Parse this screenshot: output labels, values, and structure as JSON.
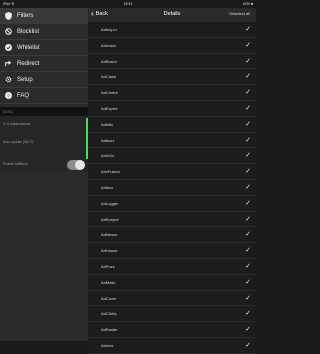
{
  "status_bar": {
    "left": "iPad 令",
    "time": "18:41",
    "battery": "60% ■"
  },
  "sidebar": {
    "items": [
      {
        "label": "Filters",
        "icon": "shield-icon",
        "active": true
      },
      {
        "label": "Blocklist",
        "icon": "block-icon",
        "active": false
      },
      {
        "label": "Whitelist",
        "icon": "check-circle-icon",
        "active": false
      },
      {
        "label": "Redirect",
        "icon": "redirect-icon",
        "active": false
      },
      {
        "label": "Setup",
        "icon": "gear-icon",
        "active": false
      },
      {
        "label": "FAQ",
        "icon": "question-icon",
        "active": false
      }
    ],
    "section_header": "BASIC",
    "settings": [
      "3 rd subscriptions",
      "Auto-update (Wi-Fi)",
      "Enable AdBlock"
    ]
  },
  "navbar": {
    "back_label": "Back",
    "title": "Details",
    "deselect_label": "Deselect all"
  },
  "list": {
    "items": [
      "Adbuy.ru",
      "Adreach",
      "AdBrand",
      "AdClash",
      "AdCentre",
      "AdExpert",
      "Adletic",
      "Adbuzz",
      "AdinOn",
      "AdvFusion",
      "Adibox",
      "AdLogger",
      "AdKeeper",
      "AdNexus",
      "AdHouse",
      "AdPuzz",
      "AdMatic",
      "AdCover",
      "AdClicks",
      "AdRoster",
      "Adnow"
    ],
    "checkmark": "✓"
  },
  "colors": {
    "accent_green": "#4cd964",
    "sidebar_bg": "#2b2b2b",
    "list_bg": "#1c1c1c"
  }
}
